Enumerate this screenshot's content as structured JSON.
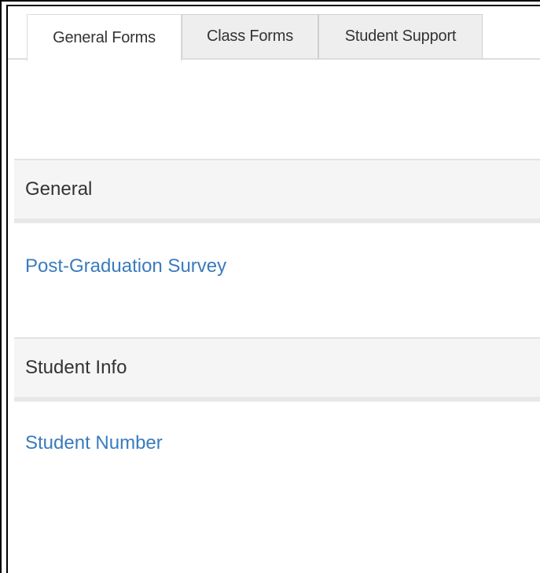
{
  "tabs": [
    {
      "label": "General Forms",
      "active": true
    },
    {
      "label": "Class Forms",
      "active": false
    },
    {
      "label": "Student Support",
      "active": false
    }
  ],
  "sections": [
    {
      "heading": "General",
      "links": [
        "Post-Graduation Survey"
      ]
    },
    {
      "heading": "Student Info",
      "links": [
        "Student Number"
      ]
    }
  ],
  "colors": {
    "link": "#3a7bbd",
    "section_bg": "#f5f5f5",
    "tab_inactive_bg": "#eeeeee",
    "border": "#dddddd"
  }
}
